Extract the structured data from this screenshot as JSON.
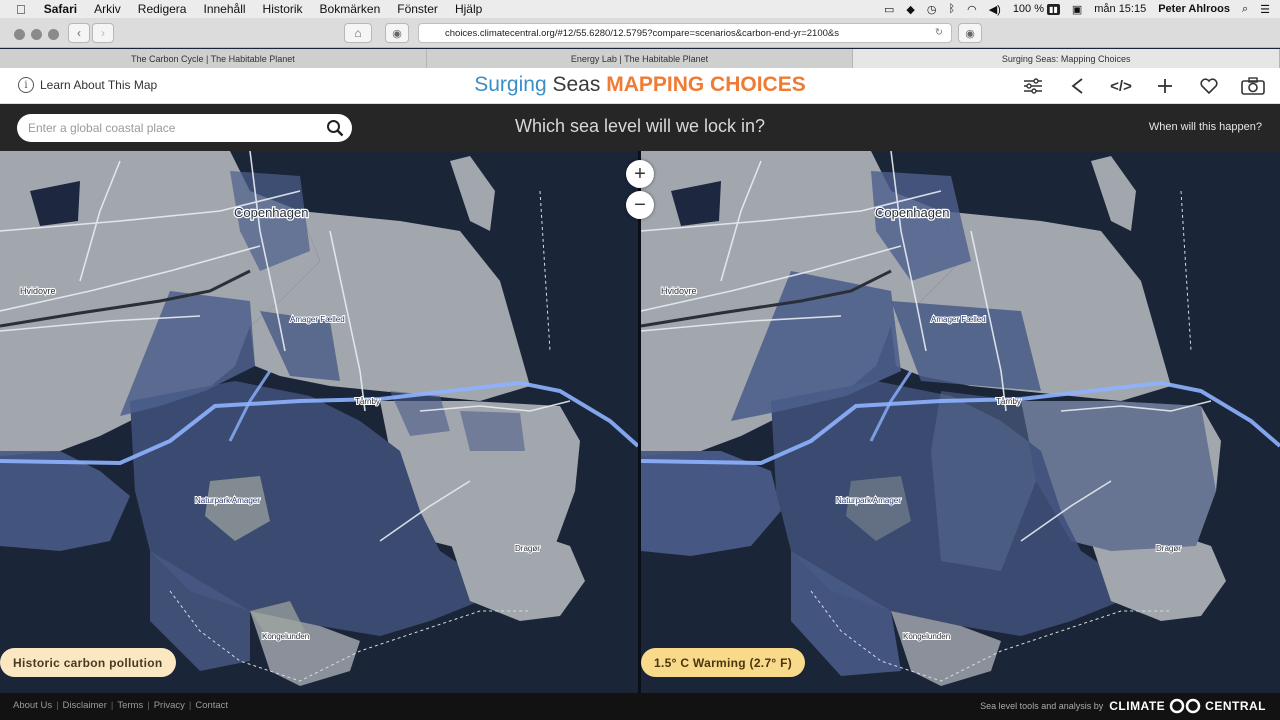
{
  "menubar": {
    "app": "Safari",
    "items": [
      "Arkiv",
      "Redigera",
      "Innehåll",
      "Historik",
      "Bokmärken",
      "Fönster",
      "Hjälp"
    ],
    "battery": "100 %",
    "clock": "mån 15:15",
    "user": "Peter Ahlroos"
  },
  "browser": {
    "url": "choices.climatecentral.org/#12/55.6280/12.5795?compare=scenarios&carbon-end-yr=2100&s",
    "tabs": [
      {
        "label": "The Carbon Cycle | The Habitable Planet"
      },
      {
        "label": "Energy Lab | The Habitable Planet"
      },
      {
        "label": "Surging Seas: Mapping Choices"
      }
    ]
  },
  "header": {
    "learn": "Learn About This Map",
    "title_part1": "Surging",
    "title_part2": "Seas",
    "title_part3": "MAPPING CHOICES"
  },
  "mapbar": {
    "search_placeholder": "Enter a global coastal place",
    "question": "Which sea level will we lock in?",
    "when": "When will this happen?"
  },
  "map_labels": {
    "city": "Copenhagen",
    "district": "Hvidovre",
    "airport_area": "Tårnby",
    "town": "Dragør",
    "kongelunden": "Kongelunden",
    "island": "Amager Fælled",
    "park": "Naturpark Amager"
  },
  "zoom": {
    "in": "+",
    "out": "−"
  },
  "scenarios": {
    "left": "Historic carbon pollution",
    "right": "1.5° C Warming (2.7° F)"
  },
  "footer": {
    "links": [
      "About Us",
      "Disclaimer",
      "Terms",
      "Privacy",
      "Contact"
    ],
    "credit": "Sea level tools and analysis by",
    "brand_left": "CLIMATE",
    "brand_right": "CENTRAL"
  },
  "colors": {
    "land": "#a2a6ad",
    "water": "#1b2538",
    "flood": "#485a86",
    "roads": "#e8ecf2",
    "highway": "#8eb2ff",
    "accent_orange": "#ef7b34",
    "accent_blue": "#3b8fc8"
  }
}
